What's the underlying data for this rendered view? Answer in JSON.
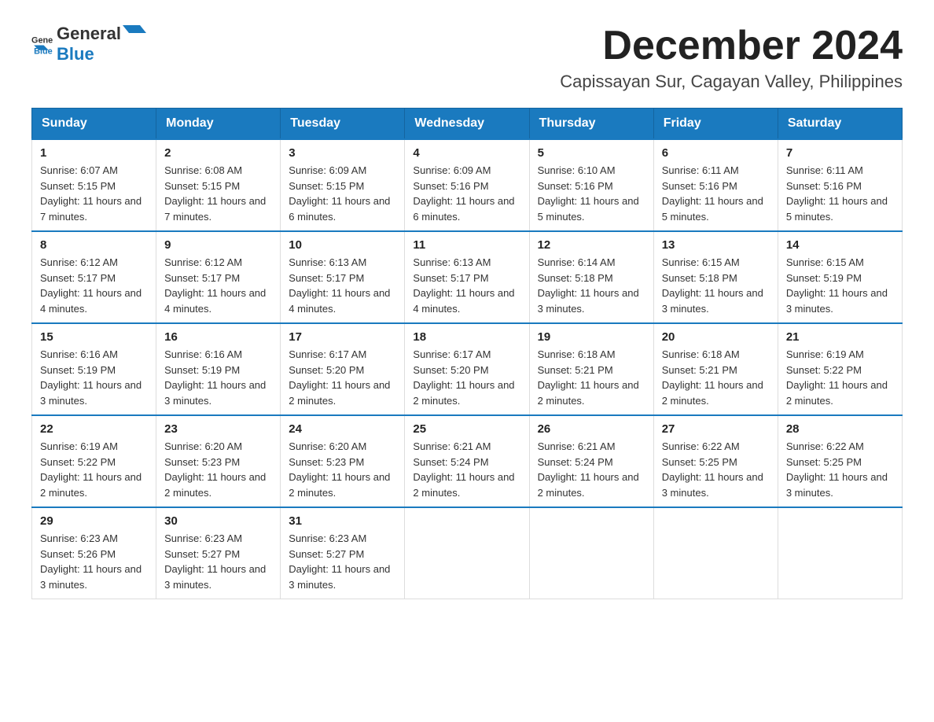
{
  "header": {
    "logo_general": "General",
    "logo_blue": "Blue",
    "month_title": "December 2024",
    "location": "Capissayan Sur, Cagayan Valley, Philippines"
  },
  "weekdays": [
    "Sunday",
    "Monday",
    "Tuesday",
    "Wednesday",
    "Thursday",
    "Friday",
    "Saturday"
  ],
  "weeks": [
    [
      {
        "day": "1",
        "sunrise": "6:07 AM",
        "sunset": "5:15 PM",
        "daylight": "11 hours and 7 minutes."
      },
      {
        "day": "2",
        "sunrise": "6:08 AM",
        "sunset": "5:15 PM",
        "daylight": "11 hours and 7 minutes."
      },
      {
        "day": "3",
        "sunrise": "6:09 AM",
        "sunset": "5:15 PM",
        "daylight": "11 hours and 6 minutes."
      },
      {
        "day": "4",
        "sunrise": "6:09 AM",
        "sunset": "5:16 PM",
        "daylight": "11 hours and 6 minutes."
      },
      {
        "day": "5",
        "sunrise": "6:10 AM",
        "sunset": "5:16 PM",
        "daylight": "11 hours and 5 minutes."
      },
      {
        "day": "6",
        "sunrise": "6:11 AM",
        "sunset": "5:16 PM",
        "daylight": "11 hours and 5 minutes."
      },
      {
        "day": "7",
        "sunrise": "6:11 AM",
        "sunset": "5:16 PM",
        "daylight": "11 hours and 5 minutes."
      }
    ],
    [
      {
        "day": "8",
        "sunrise": "6:12 AM",
        "sunset": "5:17 PM",
        "daylight": "11 hours and 4 minutes."
      },
      {
        "day": "9",
        "sunrise": "6:12 AM",
        "sunset": "5:17 PM",
        "daylight": "11 hours and 4 minutes."
      },
      {
        "day": "10",
        "sunrise": "6:13 AM",
        "sunset": "5:17 PM",
        "daylight": "11 hours and 4 minutes."
      },
      {
        "day": "11",
        "sunrise": "6:13 AM",
        "sunset": "5:17 PM",
        "daylight": "11 hours and 4 minutes."
      },
      {
        "day": "12",
        "sunrise": "6:14 AM",
        "sunset": "5:18 PM",
        "daylight": "11 hours and 3 minutes."
      },
      {
        "day": "13",
        "sunrise": "6:15 AM",
        "sunset": "5:18 PM",
        "daylight": "11 hours and 3 minutes."
      },
      {
        "day": "14",
        "sunrise": "6:15 AM",
        "sunset": "5:19 PM",
        "daylight": "11 hours and 3 minutes."
      }
    ],
    [
      {
        "day": "15",
        "sunrise": "6:16 AM",
        "sunset": "5:19 PM",
        "daylight": "11 hours and 3 minutes."
      },
      {
        "day": "16",
        "sunrise": "6:16 AM",
        "sunset": "5:19 PM",
        "daylight": "11 hours and 3 minutes."
      },
      {
        "day": "17",
        "sunrise": "6:17 AM",
        "sunset": "5:20 PM",
        "daylight": "11 hours and 2 minutes."
      },
      {
        "day": "18",
        "sunrise": "6:17 AM",
        "sunset": "5:20 PM",
        "daylight": "11 hours and 2 minutes."
      },
      {
        "day": "19",
        "sunrise": "6:18 AM",
        "sunset": "5:21 PM",
        "daylight": "11 hours and 2 minutes."
      },
      {
        "day": "20",
        "sunrise": "6:18 AM",
        "sunset": "5:21 PM",
        "daylight": "11 hours and 2 minutes."
      },
      {
        "day": "21",
        "sunrise": "6:19 AM",
        "sunset": "5:22 PM",
        "daylight": "11 hours and 2 minutes."
      }
    ],
    [
      {
        "day": "22",
        "sunrise": "6:19 AM",
        "sunset": "5:22 PM",
        "daylight": "11 hours and 2 minutes."
      },
      {
        "day": "23",
        "sunrise": "6:20 AM",
        "sunset": "5:23 PM",
        "daylight": "11 hours and 2 minutes."
      },
      {
        "day": "24",
        "sunrise": "6:20 AM",
        "sunset": "5:23 PM",
        "daylight": "11 hours and 2 minutes."
      },
      {
        "day": "25",
        "sunrise": "6:21 AM",
        "sunset": "5:24 PM",
        "daylight": "11 hours and 2 minutes."
      },
      {
        "day": "26",
        "sunrise": "6:21 AM",
        "sunset": "5:24 PM",
        "daylight": "11 hours and 2 minutes."
      },
      {
        "day": "27",
        "sunrise": "6:22 AM",
        "sunset": "5:25 PM",
        "daylight": "11 hours and 3 minutes."
      },
      {
        "day": "28",
        "sunrise": "6:22 AM",
        "sunset": "5:25 PM",
        "daylight": "11 hours and 3 minutes."
      }
    ],
    [
      {
        "day": "29",
        "sunrise": "6:23 AM",
        "sunset": "5:26 PM",
        "daylight": "11 hours and 3 minutes."
      },
      {
        "day": "30",
        "sunrise": "6:23 AM",
        "sunset": "5:27 PM",
        "daylight": "11 hours and 3 minutes."
      },
      {
        "day": "31",
        "sunrise": "6:23 AM",
        "sunset": "5:27 PM",
        "daylight": "11 hours and 3 minutes."
      },
      null,
      null,
      null,
      null
    ]
  ],
  "labels": {
    "sunrise": "Sunrise:",
    "sunset": "Sunset:",
    "daylight": "Daylight:"
  }
}
